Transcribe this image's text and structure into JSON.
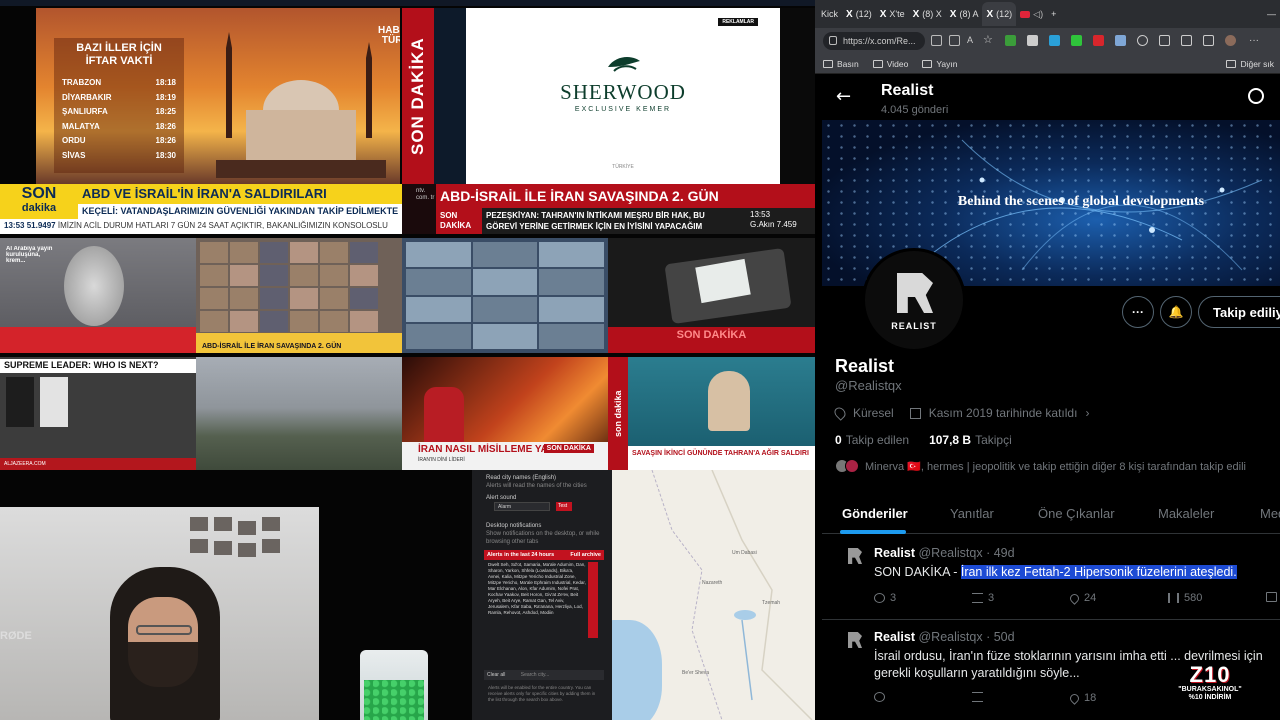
{
  "streams": {
    "iftar": {
      "title_line1": "BAZI İLLER İÇİN",
      "title_line2": "İFTAR VAKTİ",
      "rows": [
        {
          "city": "TRABZON",
          "time": "18:18"
        },
        {
          "city": "DİYARBAKIR",
          "time": "18:19"
        },
        {
          "city": "ŞANLIURFA",
          "time": "18:25"
        },
        {
          "city": "MALATYA",
          "time": "18:26"
        },
        {
          "city": "ORDU",
          "time": "18:26"
        },
        {
          "city": "SİVAS",
          "time": "18:30"
        }
      ],
      "channel_line1": "HABER",
      "channel_line2": "TÜRK"
    },
    "son_dakika_vertical": "SON DAKİKA",
    "ad": {
      "badge": "REKLAMLAR",
      "brand": "SHERWOOD",
      "sub": "EXCLUSIVE KEMER",
      "country": "TÜRKİYE"
    },
    "ticker_left": {
      "son": "SON",
      "dakika": "dakika",
      "headline": "ABD VE İSRAİL'İN İRAN'A SALDIRILARI",
      "sub1": "KEÇELİ: VATANDAŞLARIMIZIN GÜVENLİĞİ YAKINDAN TAKİP EDİLMEKTE",
      "time": "13:53",
      "index": "51.9497",
      "sub2": "İMİZİN ACİL DURUM HATLARI 7 GÜN 24 SAAT AÇIKTIR, BAKANLIĞIMIZIN KONSOLOSLU"
    },
    "ticker_right": {
      "logo": "ntv. com. tr",
      "headline": "ABD-İSRAİL İLE İRAN SAVAŞINDA 2. GÜN",
      "son": "SON",
      "dakika": "DAKİKA",
      "msg": "PEZEŞKİYAN: TAHRAN'IN İNTİKAMI MEŞRU BİR HAK, BU GÖREVİ YERİNE GETİRMEK İÇİN EN İYİSİNİ YAPACAĞIM",
      "time": "13:53",
      "index": "G.Akın 7.459"
    },
    "cells": {
      "c1_caption": "Al Arabiya yayın kuruluşuna, krem...",
      "c2_caption": "ABD-İSRAİL İLE İRAN SAVAŞINDA 2. GÜN",
      "c4_caption": "SON DAKİKA",
      "c5_header": "SUPREME LEADER: WHO IS NEXT?",
      "c5_footer": "ALJAZEERA.COM",
      "c7_question": "İRAN NASIL MİSİLLEME YAPACAK?",
      "c7_badge": "SON DAKİKA",
      "c7_footer": "İRAN'IN DİNİ LİDERİ",
      "c8_side": "son dakika",
      "c8_bar": "SAVAŞIN İKİNCİ GÜNÜNDE TAHRAN'A AĞIR SALDIRI"
    },
    "webcam_mic": "RØDE",
    "alerts": {
      "read_city": "Read city names (English)",
      "read_city_sub": "Alerts will read the names of the cities",
      "sound": "Alert sound",
      "sound_value": "Alarm",
      "test": "Test",
      "desktop": "Desktop notifications",
      "desktop_sub": "Show notifications on the desktop, or while browsing other tabs",
      "last24": "Alerts in the last 24 hours",
      "archive": "Full archive",
      "list": "Dwelt Seh, Sd'ot, Samaria, Ma'ale Adumim, Dan, Sharon, Yarkon, Shfela (Lowlands), Bika'a, Avnei, Kalia, Mitzpe Yericho Industrial Zone, Mitzpe Yericho, Ma'ale Ephraim Industrial, Kedar, Mar Elchanan, Alon, Kfar Adumim, Nofei Prat, Kochav Yaakov, Beit Horon, Giv'at Ze'ev, Beit Aryeh, Beit Arye, Ramat Gan, Tel Aviv, Jerusalem, Kfar Saba, Ra'anana, Herzliya, Lod, Ramla, Rehovot, Ashdod, Modiin",
      "clear": "Clear all",
      "search": "Search city...",
      "foot": "Alerts will be enabled for the entire country. You can receive alerts only for specific cities by adding them in the list through the search box above."
    },
    "map_labels": [
      "Um Dabasi",
      "Tzemah",
      "Nazareth",
      "Be'er Sheva"
    ]
  },
  "browser": {
    "tabs": [
      {
        "title": "Kick",
        "logo": ""
      },
      {
        "title": "(12)",
        "logo": "X"
      },
      {
        "title": "X'te",
        "logo": "X"
      },
      {
        "title": "(8) X",
        "logo": "X"
      },
      {
        "title": "(8) A",
        "logo": "X"
      },
      {
        "title": "(12)",
        "logo": "X"
      }
    ],
    "new_tab": "+",
    "url": "https://x.com/Re...",
    "bookmarks": [
      "Basın",
      "Video",
      "Yayın"
    ],
    "other_bookmarks": "Diğer sık"
  },
  "profile": {
    "name": "Realist",
    "posts_count": "4.045 gönderi",
    "banner_text": "Behind the scenes of global developments",
    "avatar_text": "REALIST",
    "follow_label": "Takip ediliyor",
    "display_name": "Realist",
    "handle": "@Realistqx",
    "location": "Küresel",
    "joined": "Kasım 2019 tarihinde katıldı",
    "following_count": "0",
    "following_label": "Takip edilen",
    "followers_count": "107,8 B",
    "followers_label": "Takipçi",
    "known_followers": "Minerva 🇹🇷, hermes | jeopolitik ve takip ettiğin diğer 8 kişi tarafından takip edili",
    "tabs": [
      "Gönderiler",
      "Yanıtlar",
      "Öne Çıkanlar",
      "Makaleler",
      "Med"
    ]
  },
  "tweets": [
    {
      "name": "Realist",
      "handle": "@Realistqx",
      "age": "49d",
      "prefix": "SON DAKİKA - ",
      "highlight": "İran ilk kez Fettah-2 Hipersonik füzelerini ateşledi.",
      "replies": "3",
      "retweets": "3",
      "likes": "24",
      "views": "580"
    },
    {
      "name": "Realist",
      "handle": "@Realistqx",
      "age": "50d",
      "text": "İsrail ordusu, İran'ın füze stoklarının yarısını imha etti ... devrilmesi için gerekli koşulların yaratıldığını söyle...",
      "replies": "",
      "retweets": "",
      "likes": "18",
      "views": ""
    }
  ],
  "promo": {
    "logo": "Z10",
    "code": "\"BURAKSAKINOL\"",
    "discount": "%10 İNDİRİM"
  }
}
